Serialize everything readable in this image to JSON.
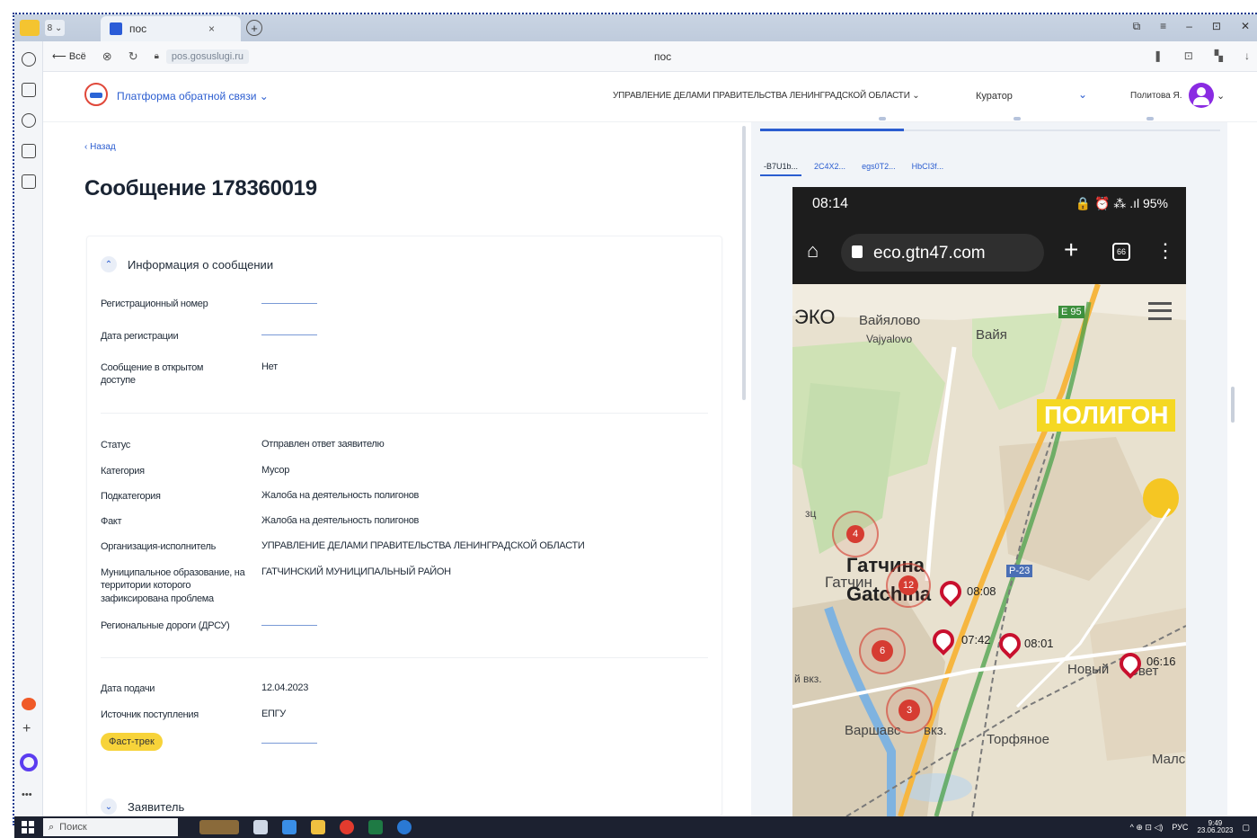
{
  "browser": {
    "tab_title": "пос",
    "tab_close": "×",
    "new_tab": "+",
    "tab_counter": "8 ⌄",
    "back_label": "⟵ Всё",
    "url": "pos.gosuslugi.ru",
    "page_title": "пос",
    "window_controls": [
      "⧉",
      "≡",
      "–",
      "⊡",
      "✕"
    ]
  },
  "header": {
    "platform_link": "Платформа обратной связи ⌄",
    "org_select": "УПРАВЛЕНИЕ ДЕЛАМИ ПРАВИТЕЛЬСТВА ЛЕНИНГРАДСКОЙ ОБЛАСТИ ⌄",
    "role_select": "Куратор",
    "role_chevron": "⌄",
    "user_name": "Политова Я.",
    "user_chevron": "⌄"
  },
  "main": {
    "back_link": "‹ Назад",
    "title": "Сообщение 178360019",
    "info_section": {
      "title": "Информация о сообщении",
      "chevron": "⌃",
      "registration_number_label": "Регистрационный номер",
      "registration_date_label": "Дата регистрации",
      "public_access_label": "Сообщение в открытом доступе",
      "public_access_value": "Нет",
      "status_label": "Статус",
      "status_value": "Отправлен ответ заявителю",
      "category_label": "Категория",
      "category_value": "Мусор",
      "subcategory_label": "Подкатегория",
      "subcategory_value": "Жалоба на деятельность полигонов",
      "fact_label": "Факт",
      "fact_value": "Жалоба на деятельность полигонов",
      "executor_label": "Организация-исполнитель",
      "executor_value": "УПРАВЛЕНИЕ ДЕЛАМИ ПРАВИТЕЛЬСТВА ЛЕНИНГРАДСКОЙ ОБЛАСТИ",
      "municipality_label": "Муниципальное образование, на территории которого зафиксирована проблема",
      "municipality_value": "ГАТЧИНСКИЙ МУНИЦИПАЛЬНЫЙ РАЙОН",
      "roads_label": "Региональные дороги (ДРСУ)",
      "submit_date_label": "Дата подачи",
      "submit_date_value": "12.04.2023",
      "source_label": "Источник поступления",
      "source_value": "ЕПГУ",
      "fast_track_badge": "Фаст-трек"
    },
    "applicant_section": {
      "title": "Заявитель",
      "chevron": "⌄"
    }
  },
  "attachments": {
    "file_tabs": [
      "-B7U1b...",
      "2C4X2...",
      "egs0T2...",
      "HbCI3f..."
    ],
    "phone": {
      "time": "08:14",
      "status_icons": "🔒 ⏰ ⁂ .ıl 95%",
      "url": "eco.gtn47.com",
      "tab_count": "66",
      "home_icon": "⌂",
      "plus_icon": "+",
      "menu_icon": "⋮",
      "map": {
        "label_eco": "ЭКО",
        "label_vaiyalovo": "Вайялово",
        "label_vaiyalovo_en": "Vajyalovo",
        "label_vaiya": "Вайя",
        "label_e95": "E 95",
        "label_polygon": "ПОЛИГОН",
        "label_gatchina": "Гатчина",
        "label_gatchina_en": "Gatchina",
        "label_gatchin": "Гатчин",
        "label_p23": "P-23",
        "label_novy": "Новый",
        "label_svet": "Свет",
        "label_varshavsky": "Варшавс",
        "label_vkz": "вкз.",
        "label_torfyanoe": "Торфяное",
        "label_malo": "Малс",
        "label_vkz2": "й вкз.",
        "label_zh": "зц",
        "cluster_4": "4",
        "cluster_12": "12",
        "cluster_6": "6",
        "cluster_3": "3",
        "pins": [
          "08:08",
          "07:42",
          "08:01",
          "06:16"
        ]
      }
    }
  },
  "taskbar": {
    "search_placeholder": "Поиск",
    "search_icon": "⌕",
    "tray_lang": "РУС",
    "clock_time": "9:49",
    "clock_date": "23.06.2023",
    "tray_icons": "^ ⊕ ⊡ ◁)"
  },
  "colors": {
    "accent": "#2b5dd0",
    "badge": "#f7d33a",
    "pin": "#c8102e",
    "polygon": "#f5d823",
    "avatar": "#8a2be2"
  }
}
